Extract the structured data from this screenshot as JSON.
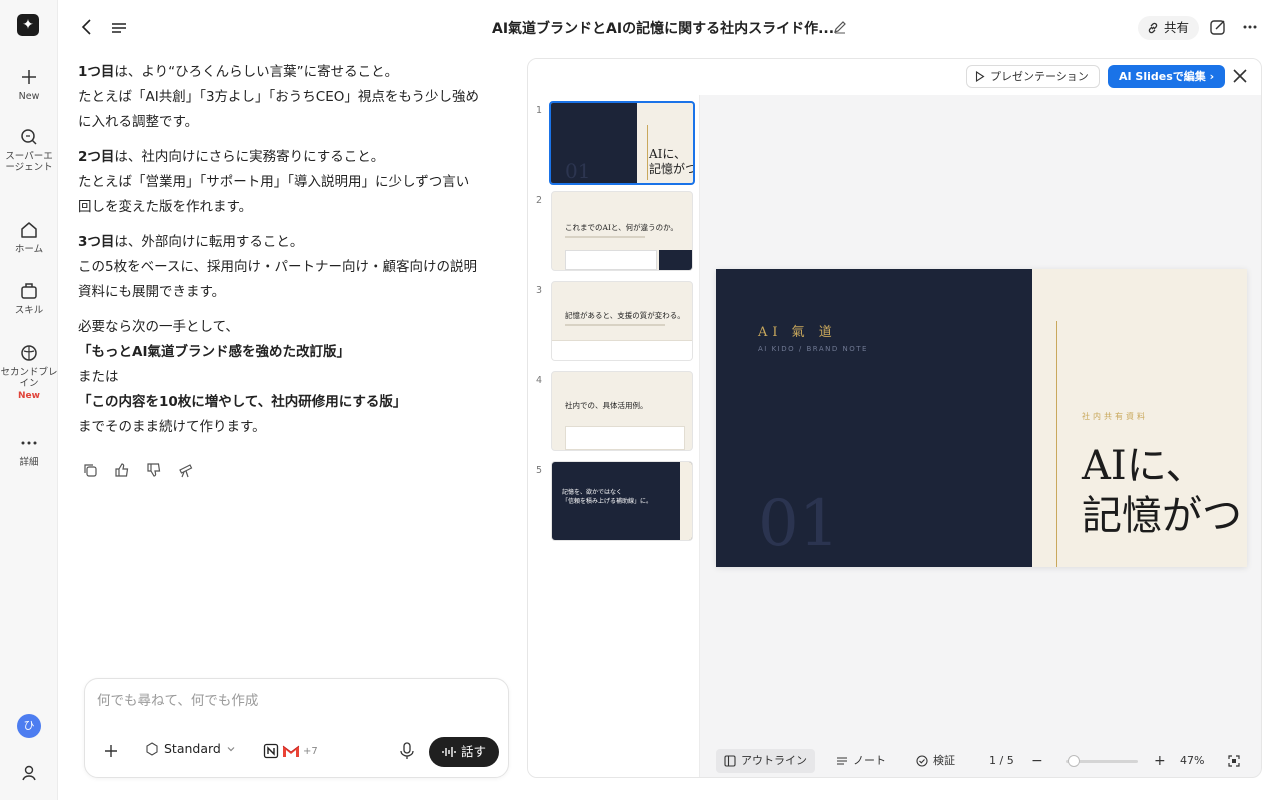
{
  "app": {
    "title": "AI氣道ブランドとAIの記憶に関する社内スライド作...",
    "share_label": "共有"
  },
  "rail": {
    "new_label": "New",
    "agent_label_1": "スーパーエ",
    "agent_label_2": "ージェント",
    "home_label": "ホーム",
    "skills_label": "スキル",
    "brain_label_1": "セカンドブレ",
    "brain_label_2": "イン",
    "brain_new_badge": "New",
    "more_label": "詳細"
  },
  "chat": {
    "p1_bold": "1つ目",
    "p1_rest": "は、より“ひろくんらしい言葉”に寄せること。",
    "p1_line2": "たとえば「AI共創」「3方よし」「おうちCEO」視点をもう少し強め",
    "p1_line3": "に入れる調整です。",
    "p2_bold": "2つ目",
    "p2_rest": "は、社内向けにさらに実務寄りにすること。",
    "p2_line2": "たとえば「営業用」「サポート用」「導入説明用」に少しずつ言い",
    "p2_line3": "回しを変えた版を作れます。",
    "p3_bold": "3つ目",
    "p3_rest": "は、外部向けに転用すること。",
    "p3_line2": "この5枚をベースに、採用向け・パートナー向け・顧客向けの説明",
    "p3_line3": "資料にも展開できます。",
    "p4_line1": "必要なら次の一手として、",
    "p4_option1": "「もっとAI氣道ブランド感を強めた改訂版」",
    "p4_or": "または",
    "p4_option2": "「この内容を10枚に増やして、社内研修用にする版」",
    "p4_end": "までそのまま続けて作ります。"
  },
  "input": {
    "placeholder": "何でも尋ねて、何でも作成",
    "model_label": "Standard",
    "connectors_more": "+7",
    "talk_label": "話す"
  },
  "panel": {
    "present_label": "プレゼンテーション",
    "edit_label": "AI Slidesで編集 ›",
    "slides": [
      {
        "num": "1"
      },
      {
        "num": "2",
        "title": "これまでのAIと、何が違うのか。"
      },
      {
        "num": "3",
        "title": "記憶があると、支援の質が変わる。"
      },
      {
        "num": "4",
        "title": "社内での、具体活用例。"
      },
      {
        "num": "5",
        "title_1": "記憶を、欲かではなく",
        "title_2": "「信頼を積み上げる補助線」に。"
      }
    ],
    "main_slide": {
      "brand": "AI 氣 道",
      "brand_sub": "AI KIDO / BRAND NOTE",
      "number": "01",
      "tag": "社内共有資料",
      "headline_1": "AIに、",
      "headline_2": "記憶がつ"
    },
    "toolbar": {
      "outline_label": "アウトライン",
      "notes_label": "ノート",
      "verify_label": "検証",
      "page_indicator": "1 / 5",
      "zoom_level": "47%"
    }
  },
  "colors": {
    "accent": "#1a73e8",
    "slide_navy": "#1c2438",
    "slide_cream": "#f4efe4",
    "slide_gold": "#c9a85c"
  }
}
